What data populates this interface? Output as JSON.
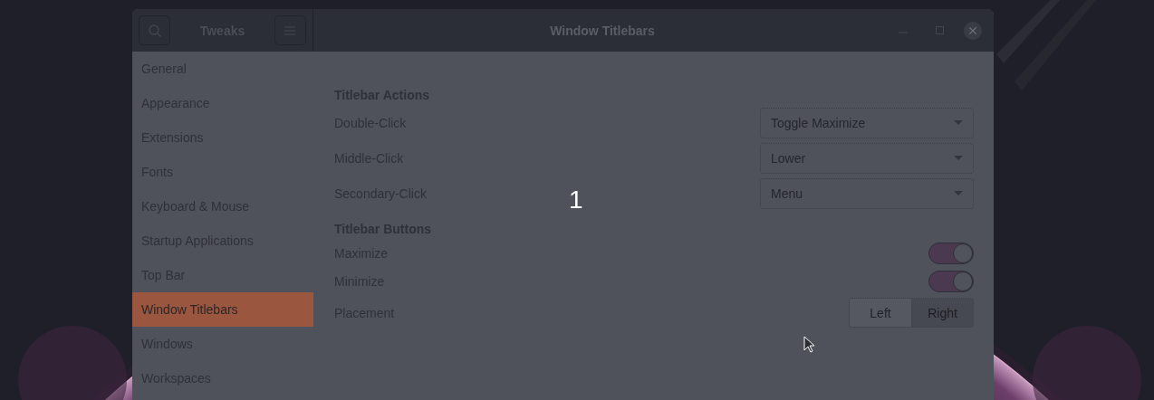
{
  "window": {
    "app_title": "Tweaks",
    "title": "Window Titlebars"
  },
  "sidebar": {
    "items": [
      {
        "label": "General",
        "selected": false
      },
      {
        "label": "Appearance",
        "selected": false
      },
      {
        "label": "Extensions",
        "selected": false
      },
      {
        "label": "Fonts",
        "selected": false
      },
      {
        "label": "Keyboard & Mouse",
        "selected": false
      },
      {
        "label": "Startup Applications",
        "selected": false
      },
      {
        "label": "Top Bar",
        "selected": false
      },
      {
        "label": "Window Titlebars",
        "selected": true
      },
      {
        "label": "Windows",
        "selected": false
      },
      {
        "label": "Workspaces",
        "selected": false
      }
    ]
  },
  "sections": [
    {
      "title": "Titlebar Actions",
      "rows": [
        {
          "kind": "dropdown",
          "label": "Double-Click",
          "value": "Toggle Maximize"
        },
        {
          "kind": "dropdown",
          "label": "Middle-Click",
          "value": "Lower"
        },
        {
          "kind": "dropdown",
          "label": "Secondary-Click",
          "value": "Menu"
        }
      ]
    },
    {
      "title": "Titlebar Buttons",
      "rows": [
        {
          "kind": "switch",
          "label": "Maximize",
          "on": true
        },
        {
          "kind": "switch",
          "label": "Minimize",
          "on": true
        },
        {
          "kind": "segmented",
          "label": "Placement",
          "options": [
            {
              "label": "Left",
              "selected": false
            },
            {
              "label": "Right",
              "selected": true
            }
          ]
        }
      ]
    }
  ],
  "overlay": {
    "text": "1"
  }
}
